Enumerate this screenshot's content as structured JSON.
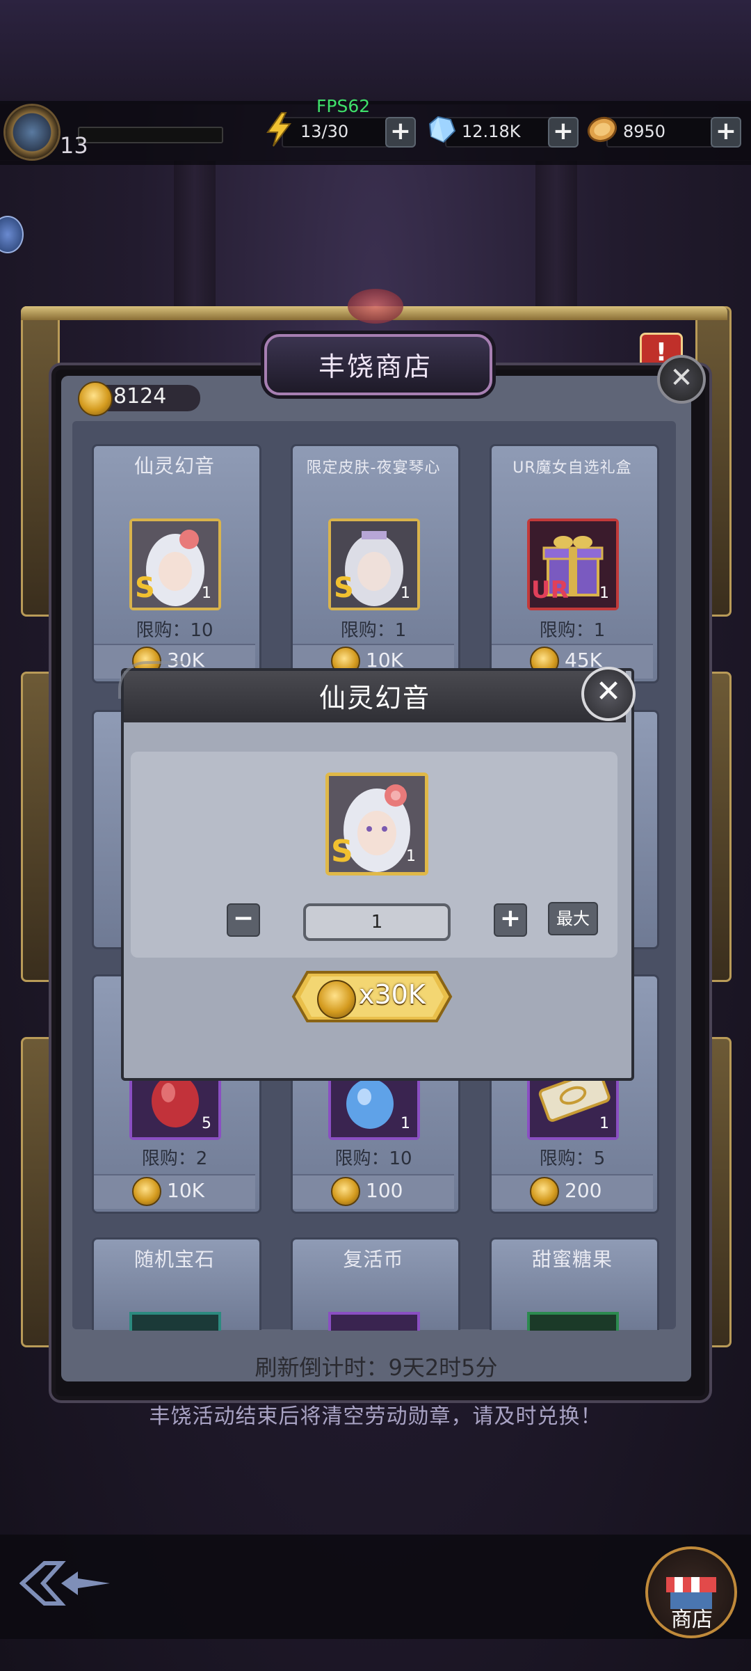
{
  "status": {
    "level": "13",
    "fps": "FPS62",
    "stamina": "13/30",
    "diamonds": "12.18K",
    "gold": "8950"
  },
  "shop": {
    "title": "丰饶商店",
    "medal_count": "8124",
    "items": [
      {
        "name": "仙灵幻音",
        "limit": "限购：10",
        "price": "30K",
        "qty": "1",
        "grade": "S"
      },
      {
        "name": "限定皮肤-夜宴琴心",
        "limit": "限购：1",
        "price": "10K",
        "qty": "1",
        "grade": "S"
      },
      {
        "name": "UR魔女自选礼盒",
        "limit": "限购：1",
        "price": "45K",
        "qty": "1",
        "grade": "UR"
      },
      {
        "name": "",
        "limit": "限购：2",
        "price": "10K",
        "qty": "5"
      },
      {
        "name": "",
        "limit": "限购：10",
        "price": "100",
        "qty": "1"
      },
      {
        "name": "",
        "limit": "限购：5",
        "price": "200",
        "qty": "1"
      },
      {
        "name": "随机宝石"
      },
      {
        "name": "复活币"
      },
      {
        "name": "甜蜜糖果"
      }
    ],
    "countdown": "刷新倒计时：9天2时5分",
    "warning": "丰饶活动结束后将清空劳动勋章，请及时兑换！",
    "store_label": "商店"
  },
  "popup": {
    "title": "仙灵幻音",
    "item_qty": "1",
    "item_grade": "S",
    "minus": "−",
    "plus": "+",
    "quantity": "1",
    "max_label": "最大",
    "price_label": "x30K"
  },
  "colors": {
    "gold_frame": "#d9b34c",
    "purple_frame": "#8a4fc2",
    "red_frame": "#c23a3a",
    "fps_green": "#3fe06a"
  }
}
